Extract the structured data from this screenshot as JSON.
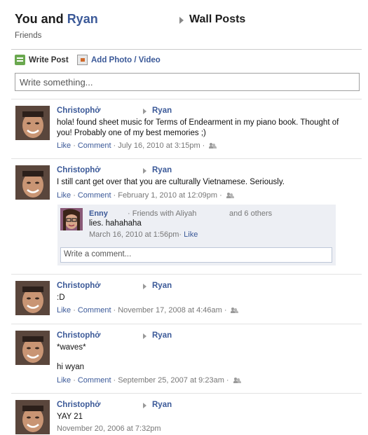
{
  "header": {
    "title_prefix": "You and",
    "title_name": "Ryan",
    "subtitle": "Friends",
    "section": "Wall Posts"
  },
  "composer": {
    "write_post": "Write Post",
    "add_photo": "Add Photo / Video",
    "placeholder": "Write something..."
  },
  "posts": [
    {
      "author": "Christophở",
      "target": "Ryan",
      "message": "hola! found sheet music for Terms of Endearment in my piano book. Thought of you! Probably one of my best memories ;)",
      "like": "Like",
      "comment": "Comment",
      "time": "July 16, 2010 at 3:15pm"
    },
    {
      "author": "Christophở",
      "target": "Ryan",
      "message": "I still cant get over that you are culturally Vietnamese. Seriously.",
      "like": "Like",
      "comment": "Comment",
      "time": "February 1, 2010 at 12:09pm",
      "comments": [
        {
          "author": "Enny",
          "friends_text": "· Friends with Aliyah",
          "others_text": "and 6 others",
          "text": "lies. hahahaha",
          "time": "March 16, 2010 at 1:56pm",
          "like": "Like"
        }
      ],
      "comment_placeholder": "Write a comment..."
    },
    {
      "author": "Christophở",
      "target": "Ryan",
      "message": ":D",
      "like": "Like",
      "comment": "Comment",
      "time": "November 17, 2008 at 4:46am"
    },
    {
      "author": "Christophở",
      "target": "Ryan",
      "message": "*waves*",
      "message2": "hi wyan",
      "like": "Like",
      "comment": "Comment",
      "time": "September 25, 2007 at 9:23am"
    },
    {
      "author": "Christophở",
      "target": "Ryan",
      "message": "YAY 21",
      "time": "November 20, 2006 at 7:32pm"
    }
  ],
  "colors": {
    "link": "#3b5998",
    "comment_bg": "#edeff4"
  }
}
